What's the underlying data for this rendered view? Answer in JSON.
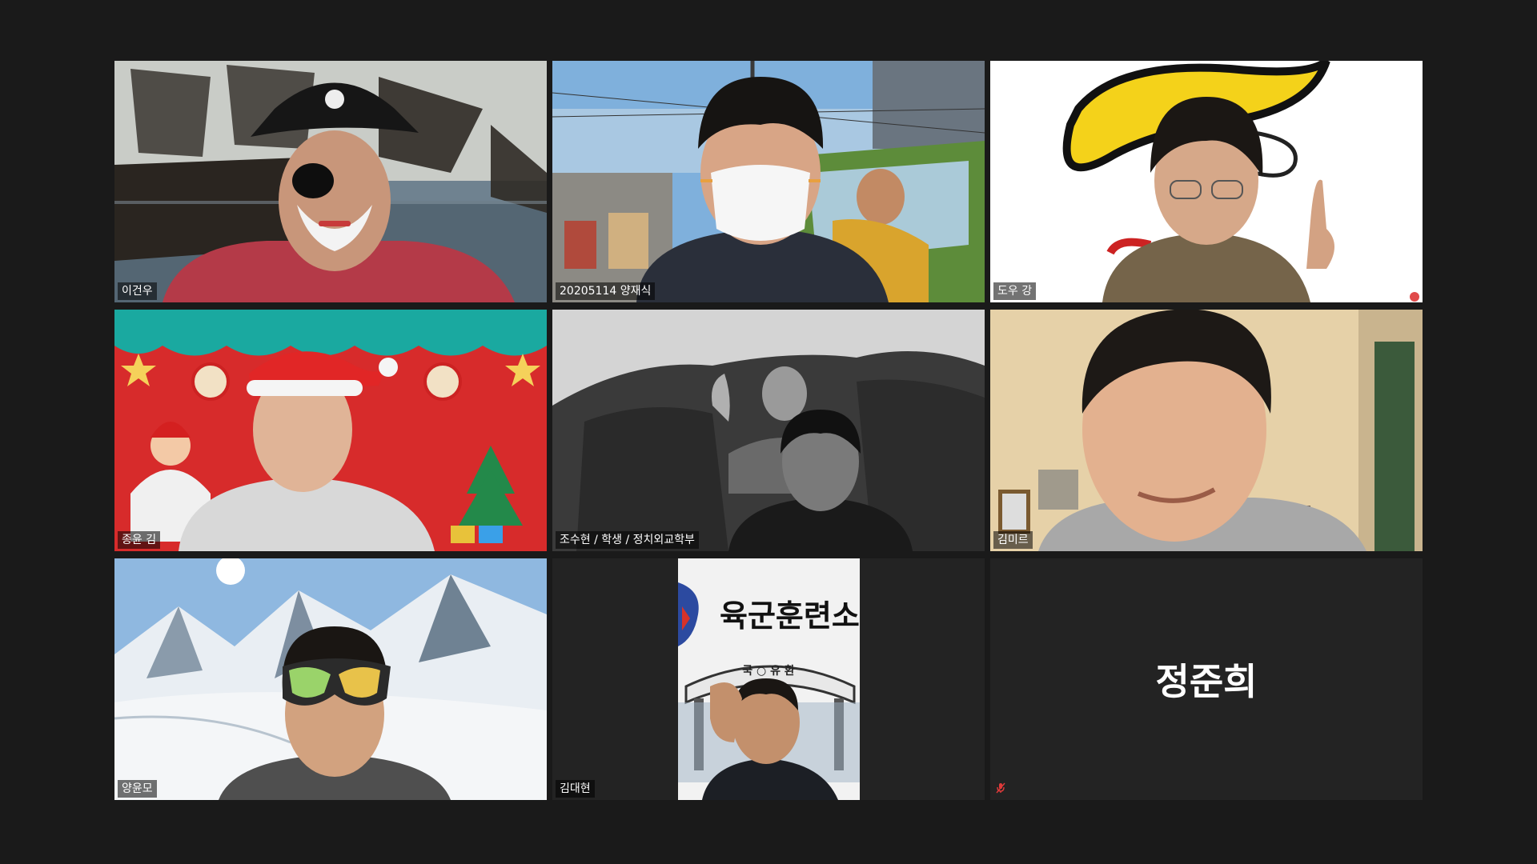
{
  "window": {
    "background": "#1a1a1a",
    "active_speaker_color": "#b6d94a"
  },
  "participants": [
    {
      "name": "이건우",
      "background": "pirate-ship",
      "muted": false
    },
    {
      "name": "20205114 양재식",
      "background": "taxi-street",
      "muted": false,
      "active_speaker": true
    },
    {
      "name": "도우 강",
      "background": "yellow-logo",
      "muted": false
    },
    {
      "name": "종윤 김",
      "background": "christmas-stage",
      "muted": false
    },
    {
      "name": "조수현 / 학생 / 정치외교학부",
      "background": "grayscale-mountain-portrait",
      "muted": false
    },
    {
      "name": "김미르",
      "background": "room",
      "muted": false
    },
    {
      "name": "양윤모",
      "background": "snowy-mountains",
      "muted": false
    },
    {
      "name": "김대현",
      "background": "army-training-center",
      "muted": false,
      "sign_text": "육군훈련소",
      "gate_text": "국 ○ 유 환"
    },
    {
      "name": "정준희",
      "video_off": true,
      "muted": true,
      "muted_icon": "mic-muted-icon",
      "display_name": "정준희"
    }
  ]
}
